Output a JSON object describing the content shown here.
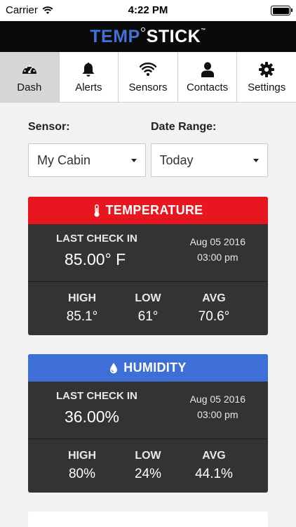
{
  "status_bar": {
    "carrier": "Carrier",
    "time": "4:22 PM"
  },
  "brand": {
    "part1": "TEMP",
    "part2": "STICK",
    "tm": "™"
  },
  "tabs": [
    {
      "label": "Dash",
      "icon": "dashboard-icon",
      "active": true
    },
    {
      "label": "Alerts",
      "icon": "bell-icon"
    },
    {
      "label": "Sensors",
      "icon": "wifi-icon"
    },
    {
      "label": "Contacts",
      "icon": "person-icon"
    },
    {
      "label": "Settings",
      "icon": "gear-icon"
    }
  ],
  "filters": {
    "sensor_label": "Sensor:",
    "sensor_value": "My Cabin",
    "range_label": "Date Range:",
    "range_value": "Today"
  },
  "temperature": {
    "title": "TEMPERATURE",
    "icon": "thermometer-icon",
    "color": "#e8161e",
    "last_check_label": "LAST CHECK IN",
    "reading": "85.00° F",
    "date": "Aug 05 2016",
    "time": "03:00 pm",
    "stats": [
      {
        "label": "HIGH",
        "value": "85.1°"
      },
      {
        "label": "LOW",
        "value": "61°"
      },
      {
        "label": "AVG",
        "value": "70.6°"
      }
    ]
  },
  "humidity": {
    "title": "HUMIDITY",
    "icon": "water-drop-icon",
    "color": "#3d6fd6",
    "last_check_label": "LAST CHECK IN",
    "reading": "36.00%",
    "date": "Aug 05 2016",
    "time": "03:00 pm",
    "stats": [
      {
        "label": "HIGH",
        "value": "80%"
      },
      {
        "label": "LOW",
        "value": "24%"
      },
      {
        "label": "AVG",
        "value": "44.1%"
      }
    ]
  }
}
